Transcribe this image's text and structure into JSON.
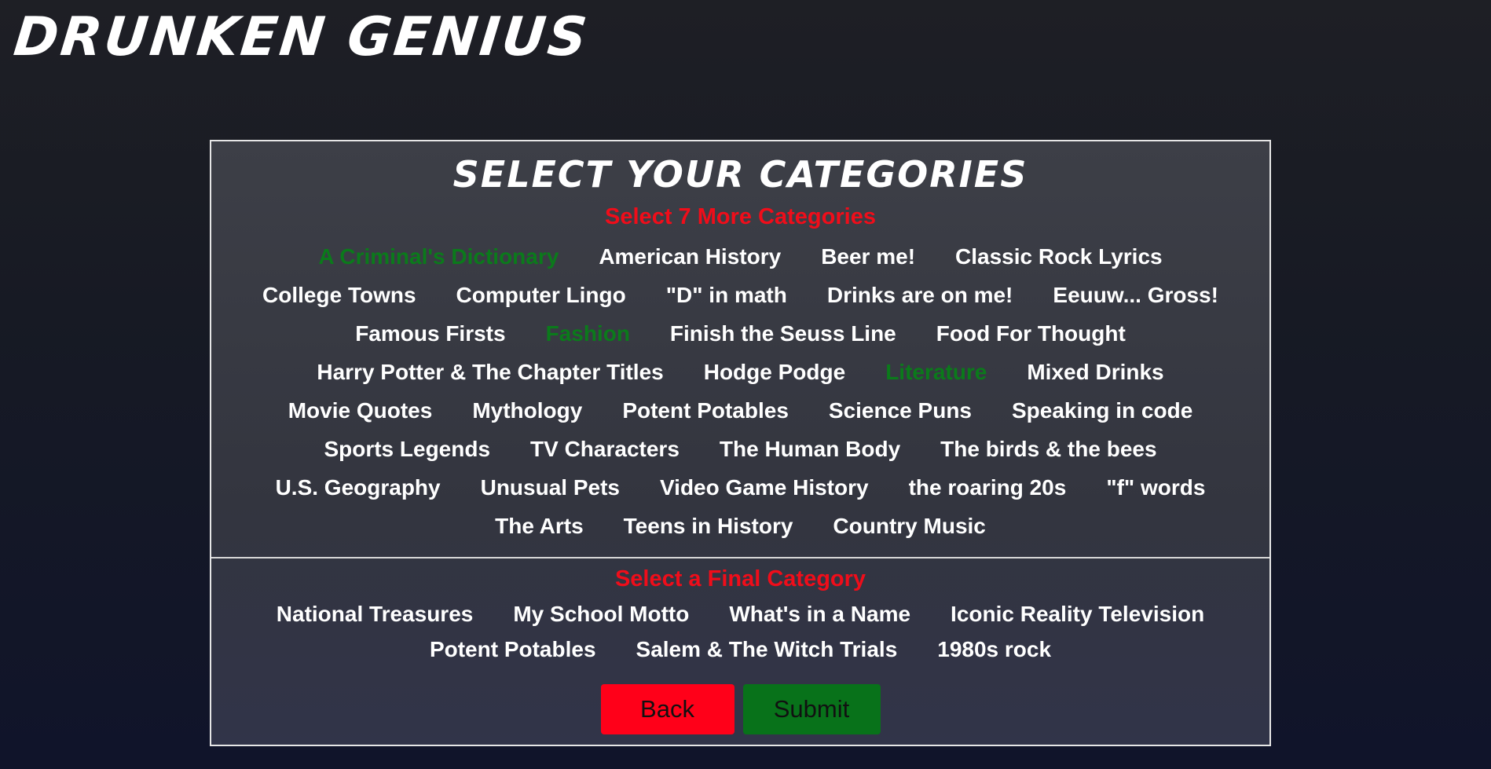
{
  "app": {
    "logo": "Drunken Genius"
  },
  "panel": {
    "title": "Select Your Categories",
    "instruction": "Select 7 More Categories",
    "categories": [
      {
        "label": "A Criminal's Dictionary",
        "selected": true
      },
      {
        "label": "American History",
        "selected": false
      },
      {
        "label": "Beer me!",
        "selected": false
      },
      {
        "label": "Classic Rock Lyrics",
        "selected": false
      },
      {
        "label": "College Towns",
        "selected": false
      },
      {
        "label": "Computer Lingo",
        "selected": false
      },
      {
        "label": "\"D\" in math",
        "selected": false
      },
      {
        "label": "Drinks are on me!",
        "selected": false
      },
      {
        "label": "Eeuuw... Gross!",
        "selected": false
      },
      {
        "label": "Famous Firsts",
        "selected": false
      },
      {
        "label": "Fashion",
        "selected": true
      },
      {
        "label": "Finish the Seuss Line",
        "selected": false
      },
      {
        "label": "Food For Thought",
        "selected": false
      },
      {
        "label": "Harry Potter & The Chapter Titles",
        "selected": false
      },
      {
        "label": "Hodge Podge",
        "selected": false
      },
      {
        "label": "Literature",
        "selected": true
      },
      {
        "label": "Mixed Drinks",
        "selected": false
      },
      {
        "label": "Movie Quotes",
        "selected": false
      },
      {
        "label": "Mythology",
        "selected": false
      },
      {
        "label": "Potent Potables",
        "selected": false
      },
      {
        "label": "Science Puns",
        "selected": false
      },
      {
        "label": "Speaking in code",
        "selected": false
      },
      {
        "label": "Sports Legends",
        "selected": false
      },
      {
        "label": "TV Characters",
        "selected": false
      },
      {
        "label": "The Human Body",
        "selected": false
      },
      {
        "label": "The birds & the bees",
        "selected": false
      },
      {
        "label": "U.S. Geography",
        "selected": false
      },
      {
        "label": "Unusual Pets",
        "selected": false
      },
      {
        "label": "Video Game History",
        "selected": false
      },
      {
        "label": "the roaring 20s",
        "selected": false
      },
      {
        "label": "\"f\" words",
        "selected": false
      },
      {
        "label": "The Arts",
        "selected": false
      },
      {
        "label": "Teens in History",
        "selected": false
      },
      {
        "label": "Country Music",
        "selected": false
      }
    ],
    "final_instruction": "Select a Final Category",
    "final_categories": [
      {
        "label": "National Treasures",
        "selected": false
      },
      {
        "label": "My School Motto",
        "selected": false
      },
      {
        "label": "What's in a Name",
        "selected": false
      },
      {
        "label": "Iconic Reality Television",
        "selected": false
      },
      {
        "label": "Potent Potables",
        "selected": false
      },
      {
        "label": "Salem & The Witch Trials",
        "selected": false
      },
      {
        "label": "1980s rock",
        "selected": false
      }
    ],
    "back_label": "Back",
    "submit_label": "Submit"
  },
  "colors": {
    "selected": "#0b7a1b",
    "instruction": "#f00d1a",
    "back_button": "#ff0019",
    "submit_button": "#08721a"
  }
}
